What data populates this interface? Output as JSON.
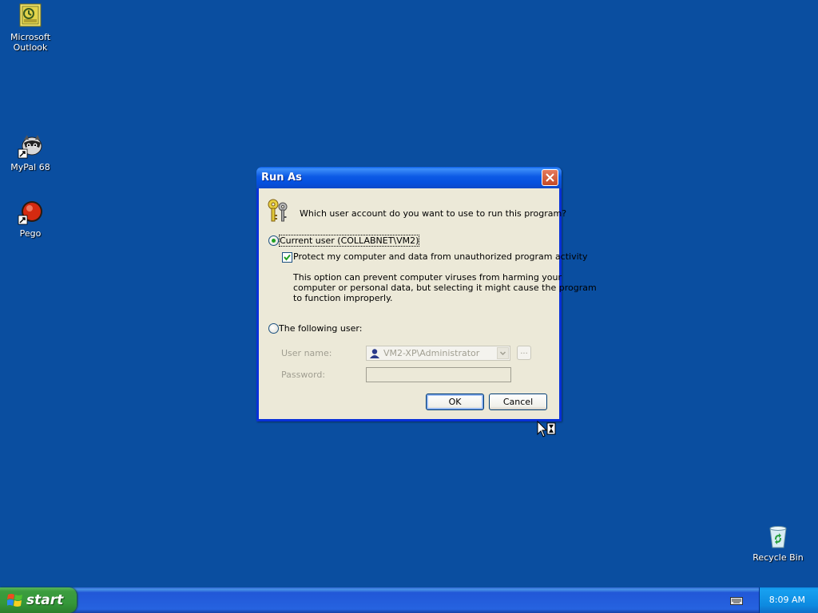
{
  "desktop": {
    "icons": [
      {
        "label_line1": "Microsoft",
        "label_line2": "Outlook",
        "icon": "outlook-icon"
      },
      {
        "label": "MyPal 68",
        "icon": "mypal-icon"
      },
      {
        "label": "Pego",
        "icon": "pego-icon"
      },
      {
        "label": "Recycle Bin",
        "icon": "recycle-bin-icon"
      }
    ]
  },
  "dialog": {
    "title": "Run As",
    "question": "Which user account do you want to use to run this program?",
    "current_user_label": "Current user (COLLABNET\\VM2)",
    "current_user_selected": true,
    "protect_label": "Protect my computer and data from unauthorized program activity",
    "protect_checked": true,
    "description_line1": "This option can prevent computer viruses from harming your",
    "description_line2": "computer or personal data, but selecting it might cause the program",
    "description_line3": "to function improperly.",
    "following_user_label": "The following user:",
    "following_user_selected": false,
    "username_label": "User name:",
    "username_value": "VM2-XP\\Administrator",
    "browse_label": "...",
    "password_label": "Password:",
    "password_value": "",
    "ok_label": "OK",
    "cancel_label": "Cancel"
  },
  "taskbar": {
    "start_label": "start",
    "clock": "8:09 AM",
    "tray_icon": "keyboard-icon"
  },
  "colors": {
    "desktop": "#0a4ea0",
    "title_bar": "#0c5ae5",
    "dialog_body": "#ece9d8",
    "start_button": "#3c9c3e",
    "close_button": "#c44a26"
  }
}
